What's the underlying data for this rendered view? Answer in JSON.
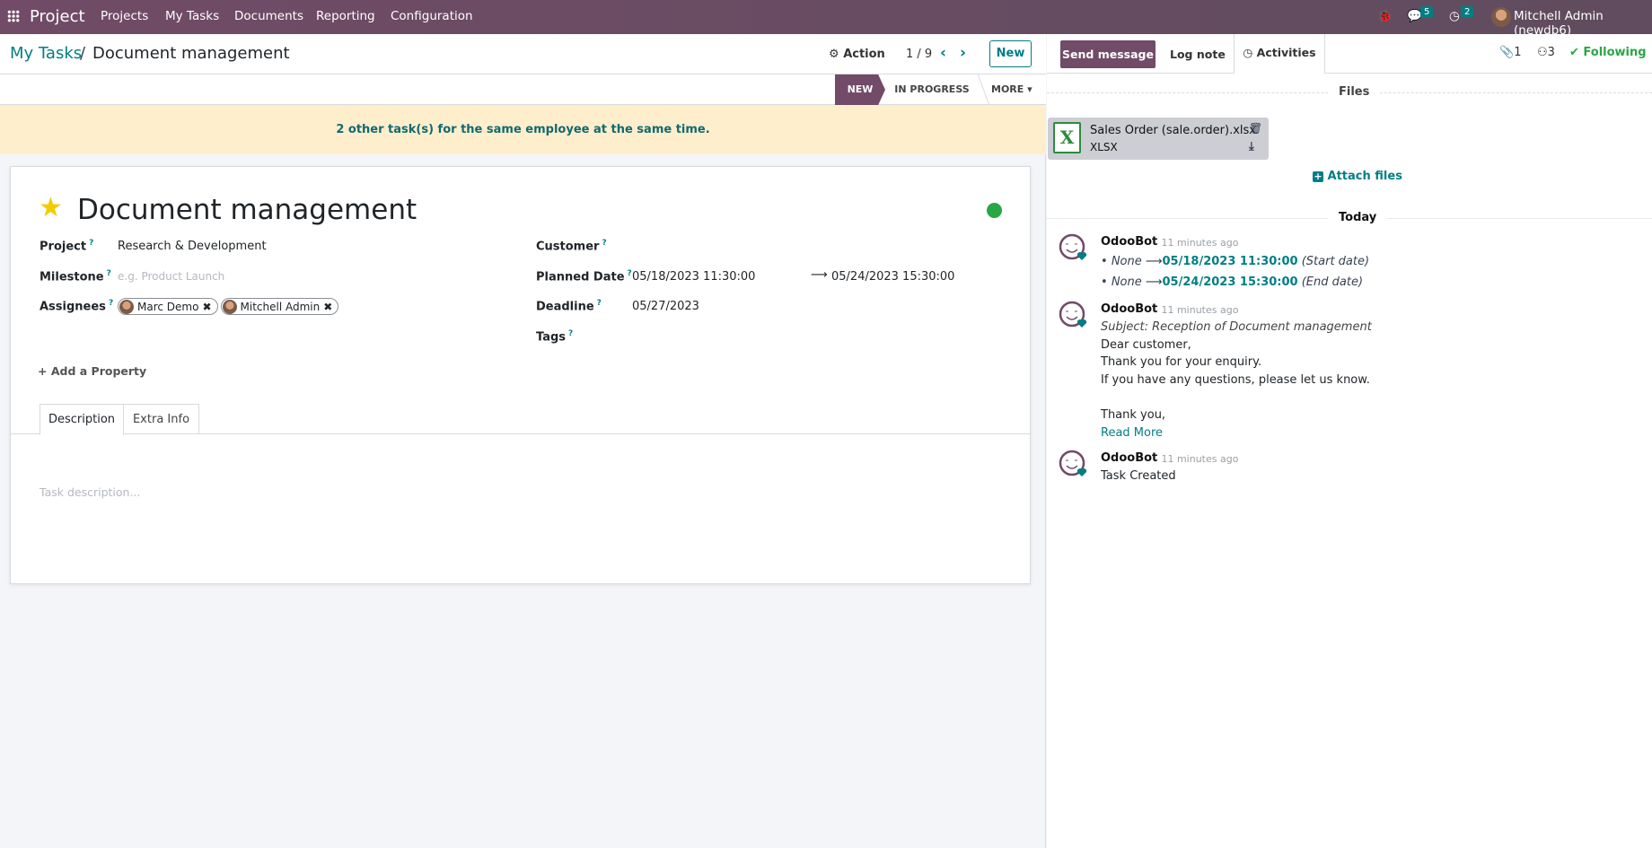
{
  "nav": {
    "app": "Project",
    "menu": [
      "Projects",
      "My Tasks",
      "Documents",
      "Reporting",
      "Configuration"
    ],
    "messages_count": "5",
    "activities_count": "2",
    "user": "Mitchell Admin (newdb6)"
  },
  "control": {
    "breadcrumb_parent": "My Tasks",
    "breadcrumb_sep": "/",
    "breadcrumb_current": "Document management",
    "action": "Action",
    "pager": "1 / 9",
    "new": "New"
  },
  "status": {
    "stages": [
      "NEW",
      "IN PROGRESS"
    ],
    "more": "MORE",
    "active": "NEW"
  },
  "alert": "2 other task(s) for the same employee at the same time.",
  "task": {
    "title": "Document management",
    "starred": true,
    "state_color": "#28a745",
    "project_label": "Project",
    "project": "Research & Development",
    "milestone_label": "Milestone",
    "milestone_placeholder": "e.g. Product Launch",
    "assignees_label": "Assignees",
    "assignees": [
      "Marc Demo",
      "Mitchell Admin"
    ],
    "customer_label": "Customer",
    "planned_label": "Planned Date",
    "planned_start": "05/18/2023 11:30:00",
    "planned_end": "05/24/2023 15:30:00",
    "deadline_label": "Deadline",
    "deadline": "05/27/2023",
    "tags_label": "Tags",
    "help": "?",
    "add_property": "Add a Property",
    "tabs": [
      "Description",
      "Extra Info"
    ],
    "description_placeholder": "Task description..."
  },
  "chatter": {
    "send": "Send message",
    "log": "Log note",
    "activities": "Activities",
    "attachments": "1",
    "followers": "3",
    "following": "Following",
    "files_label": "Files",
    "file": {
      "name": "Sales Order (sale.order).xlsx",
      "type": "XLSX"
    },
    "attach": "Attach files",
    "today": "Today",
    "messages": [
      {
        "author": "OdooBot",
        "time": "- 11 minutes ago",
        "changes": [
          {
            "old": "None",
            "new": "05/18/2023 11:30:00",
            "field": "(Start date)"
          },
          {
            "old": "None",
            "new": "05/24/2023 15:30:00",
            "field": "(End date)"
          }
        ]
      },
      {
        "author": "OdooBot",
        "time": "- 11 minutes ago",
        "subject": "Subject: Reception of Document management",
        "lines": [
          "Dear customer,",
          "Thank you for your enquiry.",
          "If you have any questions, please let us know."
        ],
        "closing": "Thank you,",
        "read_more": "Read More"
      },
      {
        "author": "OdooBot",
        "time": "- 11 minutes ago",
        "body": "Task Created"
      }
    ]
  },
  "colors": {
    "brand": "#714b67",
    "accent": "#017e84"
  }
}
